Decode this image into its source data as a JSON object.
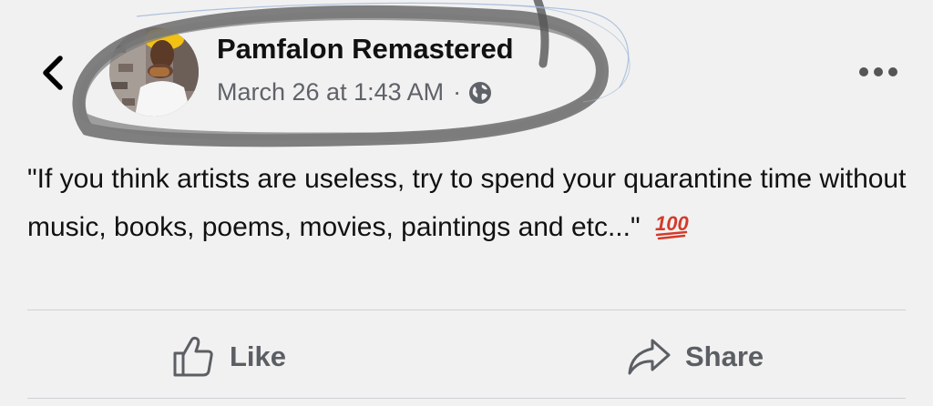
{
  "post": {
    "author": "Pamfalon Remastered",
    "date": "March 26 at 1:43 AM",
    "separator": "·",
    "privacy_icon": "globe-icon",
    "text": "\"If you think artists are useless, try to spend your quarantine time without music, books, poems, movies,  paintings and etc...\"",
    "emoji": "💯"
  },
  "actions": {
    "like_label": "Like",
    "share_label": "Share"
  },
  "icons": {
    "back": "chevron-left-icon",
    "more": "more-horizontal-icon",
    "like": "thumbs-up-icon",
    "share": "share-arrow-icon"
  },
  "colors": {
    "background": "#f1f1f1",
    "name_text": "#111111",
    "meta_text": "#5f6268",
    "action_text": "#5b5e63",
    "scribble": "#6b6b6b",
    "emoji_red": "#d23b2a"
  }
}
